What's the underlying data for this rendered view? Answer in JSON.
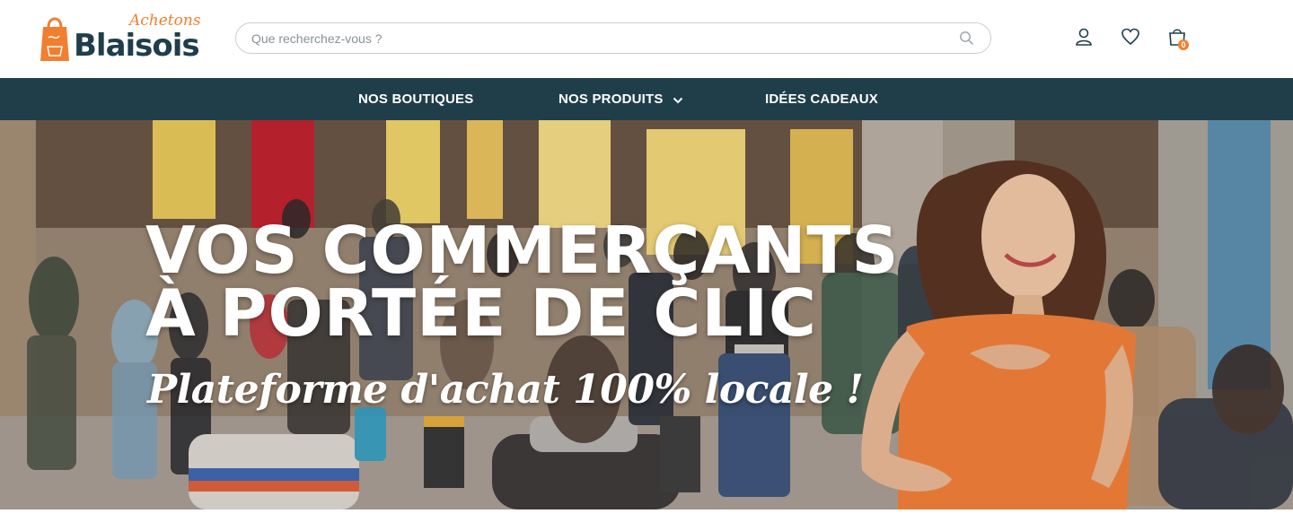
{
  "logo": {
    "top_word": "Achetons",
    "main_word": "Blaisois"
  },
  "search": {
    "placeholder": "Que recherchez-vous ?"
  },
  "header_icons": {
    "account": "user-icon",
    "wishlist": "heart-icon",
    "cart": "shopping-bag-icon",
    "cart_count": "0"
  },
  "nav": {
    "items": [
      {
        "label": "NOS BOUTIQUES"
      },
      {
        "label": "NOS PRODUITS",
        "has_dropdown": true
      },
      {
        "label": "IDÉES CADEAUX"
      }
    ]
  },
  "hero": {
    "title_line1": "VOS COMMERÇANTS",
    "title_line2": "À PORTÉE DE CLIC",
    "subtitle": "Plateforme d'achat 100% locale !"
  },
  "colors": {
    "brand_dark": "#1f3e4a",
    "brand_orange": "#f27e2f",
    "nav_text": "#ffffff"
  }
}
